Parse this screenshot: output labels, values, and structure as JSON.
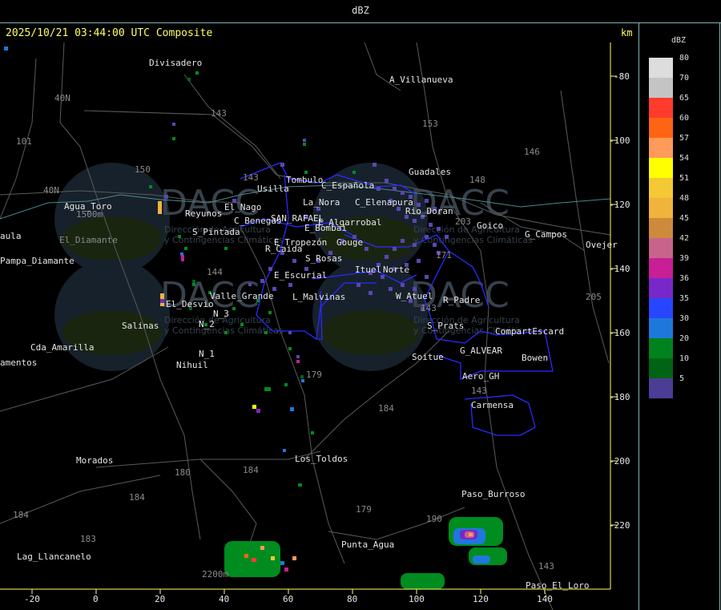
{
  "header": {
    "title": "dBZ"
  },
  "timestamp": "2025/10/21 03:44:00 UTC Composite",
  "unit_top": "km",
  "unit_bottom": "km",
  "colors": {
    "axis": "#ffff66",
    "border": "#7fb3b3",
    "boundary": "#2a2aff",
    "roads": "#555555",
    "river": "#5aa0a0"
  },
  "legend": {
    "title": "dBZ",
    "items": [
      {
        "label": "80",
        "color": "#dddddd"
      },
      {
        "label": "70",
        "color": "#c4c4c4"
      },
      {
        "label": "65",
        "color": "#ff3b2b"
      },
      {
        "label": "60",
        "color": "#ff6414"
      },
      {
        "label": "57",
        "color": "#ff9a5a"
      },
      {
        "label": "54",
        "color": "#ffff00"
      },
      {
        "label": "51",
        "color": "#f5c835"
      },
      {
        "label": "48",
        "color": "#f0b43c"
      },
      {
        "label": "45",
        "color": "#cd8a3c"
      },
      {
        "label": "42",
        "color": "#c8648c"
      },
      {
        "label": "39",
        "color": "#c81e96"
      },
      {
        "label": "36",
        "color": "#7828c8"
      },
      {
        "label": "35",
        "color": "#2846ff"
      },
      {
        "label": "30",
        "color": "#1e78dc"
      },
      {
        "label": "20",
        "color": "#00821e"
      },
      {
        "label": "10",
        "color": "#006414"
      },
      {
        "label": "5",
        "color": "#4b3c96"
      }
    ]
  },
  "x_ticks": [
    "-20",
    "0",
    "20",
    "40",
    "60",
    "80",
    "100",
    "120",
    "140"
  ],
  "y_ticks": [
    "-80",
    "-100",
    "-120",
    "-140",
    "-160",
    "-180",
    "-200",
    "-220"
  ],
  "places": [
    "Divisadero",
    "A_Villanueva",
    "Guadales",
    "Agua_Toro",
    "Reyunos",
    "El_Nago",
    "S_Pintada",
    "C_Benegas",
    "SAN_RAFAEL",
    "E_Algarrobal",
    "Usilla",
    "Tombulo",
    "La_Nora",
    "C_Española",
    "C_Elenapura",
    "Rio_Doran",
    "Goico",
    "G_Campos",
    "Ovejer",
    "E_Bombai",
    "E_Tropezón",
    "Gouge",
    "R_Caida",
    "S_Rosas",
    "Ituel",
    "Norte",
    "E_Escurial",
    "Valle_Grande",
    "L_Malvinas",
    "W_Atuel",
    "R_Padre",
    "El_Desvio",
    "Salinas",
    "N_2",
    "N_3",
    "N_1",
    "Nihuil",
    "S_Prats",
    "CompartEscard",
    "G_ALVEAR",
    "Bowen",
    "Soitue",
    "Aero_GH",
    "Carmensa",
    "Cda_Amarilla",
    "amentos",
    "Pampa_Diamante",
    "aula",
    "Morados",
    "Los_Toldos",
    "Paso_Burroso",
    "Punta_Agua",
    "Lag_Llancanelo",
    "Paso_El_Loro",
    "El_Diamante"
  ],
  "routes": [
    "143",
    "153",
    "146",
    "148",
    "40N",
    "101",
    "150",
    "203",
    "171",
    "144",
    "179",
    "184",
    "180",
    "183",
    "205",
    "190"
  ],
  "elevations": [
    "1500m",
    "2200m"
  ],
  "watermark": {
    "brand": "DACC",
    "subtitle_a": "Dirección de Agricultura",
    "subtitle_b": "y Contingencias Climáticas"
  }
}
